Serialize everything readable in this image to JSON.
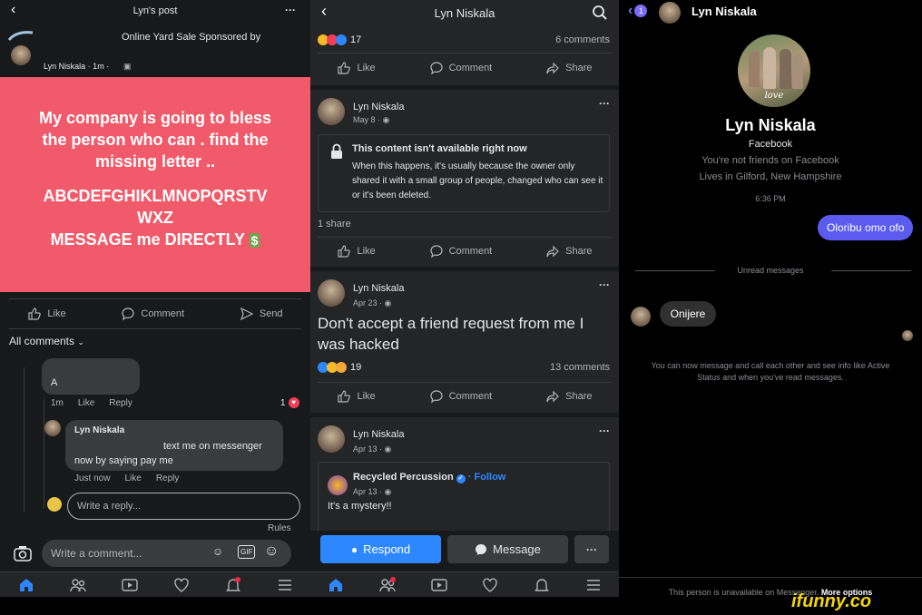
{
  "left": {
    "header": {
      "title": "Lyn's post"
    },
    "shared_post": {
      "title_line": "Online Yard Sale Sponsored by",
      "meta": "Lyn Niskala · 1m ·"
    },
    "image_text": {
      "line1": "My company is going to bless",
      "line2": "the person who  can . find the",
      "line3": "missing letter  ..",
      "line4": "ABCDEFGHIKLMNOPQRSTV",
      "line5": "WXZ",
      "line6": "MESSAGE me DIRECTLY"
    },
    "actions": {
      "like": "Like",
      "comment": "Comment",
      "send": "Send"
    },
    "all_comments": "All comments",
    "comment1": {
      "text": "A",
      "time": "1m",
      "like": "Like",
      "reply": "Reply",
      "reactions": "1"
    },
    "reply1": {
      "author": "Lyn Niskala",
      "text": "text me on messenger now by saying pay me",
      "time": "Just now",
      "like": "Like",
      "reply": "Reply"
    },
    "reply_input": {
      "placeholder": "Write a reply..."
    },
    "rules": "Rules",
    "comment_input": {
      "placeholder": "Write a comment..."
    }
  },
  "middle": {
    "header": {
      "title": "Lyn Niskala"
    },
    "post0": {
      "reactions": "17",
      "comments": "6 comments"
    },
    "actions": {
      "like": "Like",
      "comment": "Comment",
      "share": "Share"
    },
    "post1": {
      "author": "Lyn Niskala",
      "date": "May 8 ·",
      "unavailable_title": "This content isn't available right now",
      "unavailable_body": "When this happens, it's usually because the owner only shared it with a small group of people, changed who can see it or it's been deleted.",
      "shares": "1 share"
    },
    "post2": {
      "author": "Lyn Niskala",
      "date": "Apr 23 ·",
      "text": "Don't accept a friend request from me I was hacked",
      "reactions": "19",
      "comments": "13 comments"
    },
    "post3": {
      "author": "Lyn Niskala",
      "date": "Apr 13 ·",
      "shared_author": "Recycled Percussion",
      "follow": "· Follow",
      "shared_date": "Apr 13 ·",
      "shared_text": "It's a mystery!!"
    },
    "buttons": {
      "respond": "Respond",
      "message": "Message",
      "more": "···"
    }
  },
  "right": {
    "header": {
      "badge": "1",
      "name": "Lyn Niskala"
    },
    "profile": {
      "name": "Lyn Niskala",
      "platform": "Facebook",
      "friend_status": "You're not friends on Facebook",
      "location": "Lives in Gilford, New Hampshire",
      "avatar_caption": "love"
    },
    "time": "6:36 PM",
    "sent_message": "Oloribu omo ofo",
    "unread": "Unread messages",
    "received_message": "Onijere",
    "info": "You can now message and call each other and see info like Active Status and when you've read messages.",
    "footer": {
      "text": "This person is unavailable on Messenger.",
      "link": "More options"
    }
  },
  "watermark": "ifunny.co",
  "colors": {
    "bg": "#18191a",
    "card": "#242526",
    "accent": "#2d88ff",
    "pink": "#f15a6a",
    "purple": "#5b5bf0"
  }
}
